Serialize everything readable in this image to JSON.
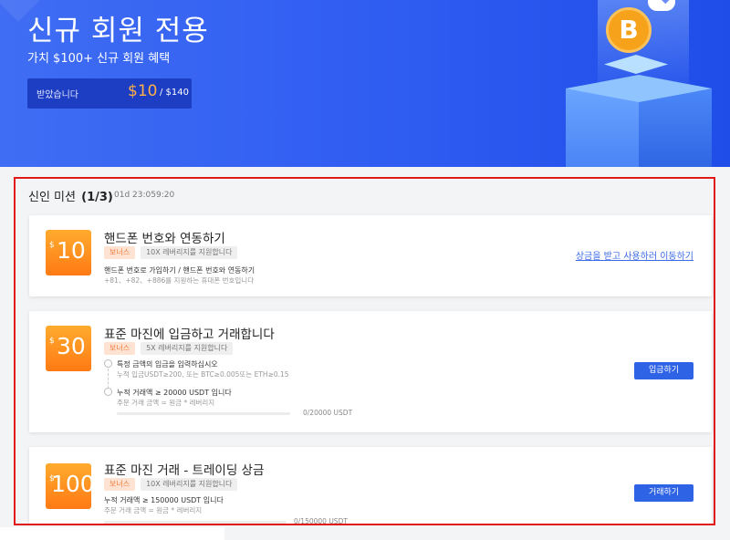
{
  "hero": {
    "title": "신규 회원 전용",
    "subtitle": "가치 $100+ 신규 회원 혜택",
    "received_label": "받았습니다",
    "received_amount": "$10",
    "received_total": " / $140",
    "colors": {
      "background": "#2f5cf1",
      "accent": "#ffb04a"
    }
  },
  "illustration": {
    "coin_symbol": "B",
    "coin_icon": "bitcoin-icon",
    "top_icon": "ethereum-icon"
  },
  "missions": {
    "heading": "신인 미션",
    "progress": "(1/3)",
    "timer": "01d 23:059:20",
    "cards": [
      {
        "currency": "$",
        "amount": "10",
        "title": "핸드폰 번호와 연동하기",
        "tag_bonus": "보너스",
        "tag_leverage": "10X 레버리지를 지원합니다",
        "line1": "핸드폰 번호로 가입하기 / 핸드폰 번호와 연동하기",
        "line2": "+81、+82、+886를 지원하는 휴대폰 번호입니다",
        "action_link": "상금을 받고 사용하러 이동하기"
      },
      {
        "currency": "$",
        "amount": "30",
        "title": "표준 마진에 입금하고 거래합니다",
        "tag_bonus": "보너스",
        "tag_leverage": "5X 레버리지를 지원합니다",
        "step1": "특정 금액의 입금을 입력하십시오",
        "step1_sub": "누적 입금USDT≥200, 또는 BTC≥0.005또는 ETH≥0.15",
        "step2": "누적 거래액 ≥ 20000 USDT 입니다",
        "step2_sub": "주문 거래 금액 = 원금 * 레버리지",
        "progress_label": "0/20000 USDT",
        "progress_value": 0,
        "action_button": "입금하기"
      },
      {
        "currency": "$",
        "amount": "100",
        "title": "표준 마진 거래 - 트레이딩 상금",
        "tag_bonus": "보너스",
        "tag_leverage": "10X 레버리지를 지원합니다",
        "line1": "누적 거래액 ≥ 150000 USDT 입니다",
        "line2": "주문 거래 금액 = 원금 * 레버리지",
        "progress_label": "0/150000 USDT",
        "progress_value": 0,
        "action_button": "거래하기"
      }
    ]
  }
}
